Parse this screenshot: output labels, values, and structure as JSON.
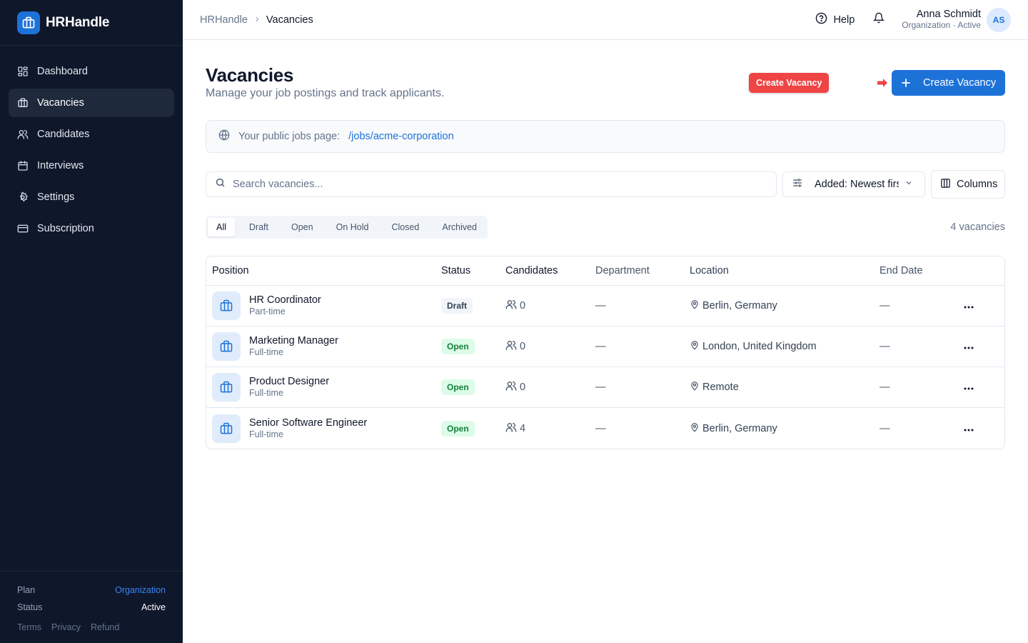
{
  "app": {
    "name": "HRHandle"
  },
  "sidebar": {
    "items": [
      {
        "label": "Dashboard",
        "icon": "dashboard-icon"
      },
      {
        "label": "Vacancies",
        "icon": "briefcase-icon",
        "active": true
      },
      {
        "label": "Candidates",
        "icon": "users-icon"
      },
      {
        "label": "Interviews",
        "icon": "calendar-icon"
      },
      {
        "label": "Settings",
        "icon": "gear-icon"
      },
      {
        "label": "Subscription",
        "icon": "credit-card-icon"
      }
    ],
    "footer": {
      "plan_label": "Plan",
      "plan_value": "Organization",
      "status_label": "Status",
      "status_value": "Active",
      "links": [
        "Terms",
        "Privacy",
        "Refund"
      ]
    }
  },
  "header": {
    "breadcrumb": [
      "HRHandle",
      "Vacancies"
    ],
    "help_label": "Help",
    "user": {
      "name": "Anna Schmidt",
      "subtitle": "Organization · Active",
      "initials": "AS"
    }
  },
  "page": {
    "title": "Vacancies",
    "subtitle": "Manage your job postings and track applicants.",
    "annotation_badge": "Create Vacancy",
    "create_button": "Create Vacancy",
    "public_jobs": {
      "label": "Your public jobs page:",
      "link": "/jobs/acme-corporation"
    },
    "search_placeholder": "Search vacancies...",
    "sort_label": "Added: Newest first",
    "columns_label": "Columns",
    "tabs": [
      "All",
      "Draft",
      "Open",
      "On Hold",
      "Closed",
      "Archived"
    ],
    "active_tab": "All",
    "count_text": "4 vacancies"
  },
  "table": {
    "headers": [
      "Position",
      "Status",
      "Candidates",
      "Department",
      "Location",
      "End Date"
    ],
    "rows": [
      {
        "title": "HR Coordinator",
        "type": "Part-time",
        "status": "Draft",
        "candidates": "0",
        "department": "—",
        "location": "Berlin, Germany",
        "end_date": "—"
      },
      {
        "title": "Marketing Manager",
        "type": "Full-time",
        "status": "Open",
        "candidates": "0",
        "department": "—",
        "location": "London, United Kingdom",
        "end_date": "—"
      },
      {
        "title": "Product Designer",
        "type": "Full-time",
        "status": "Open",
        "candidates": "0",
        "department": "—",
        "location": "Remote",
        "end_date": "—"
      },
      {
        "title": "Senior Software Engineer",
        "type": "Full-time",
        "status": "Open",
        "candidates": "4",
        "department": "—",
        "location": "Berlin, Germany",
        "end_date": "—"
      }
    ]
  },
  "colors": {
    "sidebar_bg": "#0f172a",
    "accent": "#1d72d8",
    "annotation_red": "#ef4444",
    "open_bg": "#dcfce7",
    "open_text": "#15803d"
  }
}
